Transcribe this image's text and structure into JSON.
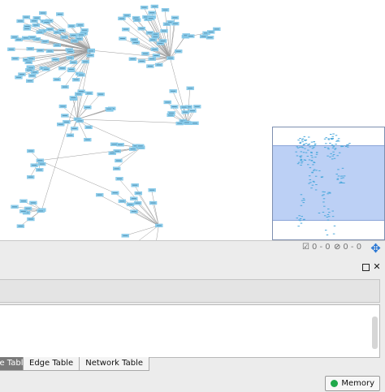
{
  "canvas": {
    "node_color": "#8fd0ee",
    "edge_color": "#9b9b9b",
    "label_color": "#1d4f73"
  },
  "overview": {
    "viewport_color": "#bcd0f5"
  },
  "status": {
    "selected_count": "0 - 0",
    "hidden_count": "0 - 0"
  },
  "panel": {
    "tabs": [
      {
        "label": "ode Table",
        "active": true
      },
      {
        "label": "Edge Table",
        "active": false
      },
      {
        "label": "Network Table",
        "active": false
      }
    ]
  },
  "bottom": {
    "memory_label": "Memory",
    "memory_status_color": "#1fa84a"
  }
}
